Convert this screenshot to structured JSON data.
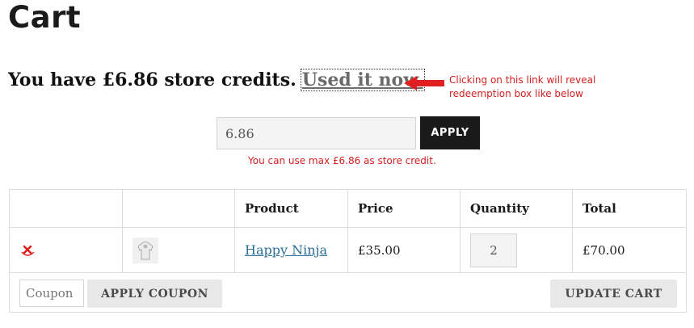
{
  "page": {
    "title": "Cart"
  },
  "credits": {
    "text": "You have £6.86 store credits.",
    "link_label": "Used it now."
  },
  "annotation": {
    "line1": "Clicking on this link will reveal",
    "line2": "redeemption box like below",
    "color": "#d22020"
  },
  "redeem": {
    "value": "6.86",
    "apply_label": "APPLY",
    "message": "You can use max £6.86 as store credit."
  },
  "table": {
    "columns": [
      "",
      "",
      "Product",
      "Price",
      "Quantity",
      "Total"
    ],
    "rows": [
      {
        "remove_icon": "close-icon",
        "thumbnail_icon": "hoodie-icon",
        "product": "Happy Ninja",
        "price": "£35.00",
        "quantity": "2",
        "total": "£70.00"
      }
    ]
  },
  "actions": {
    "coupon_placeholder": "Coupon",
    "apply_coupon_label": "APPLY COUPON",
    "update_cart_label": "UPDATE CART"
  },
  "colors": {
    "accent_link": "#2a6e97",
    "button_dark": "#1a1a1a",
    "button_light": "#e8e8e8",
    "error_red": "#d22020"
  }
}
